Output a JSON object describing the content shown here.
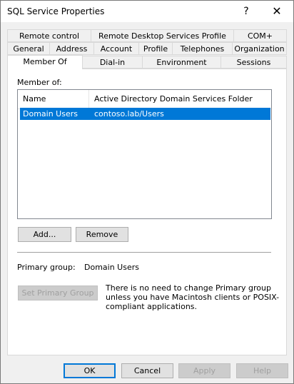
{
  "window": {
    "title": "SQL Service Properties",
    "help_glyph": "?",
    "close_glyph": "✕"
  },
  "tabs": {
    "row1": [
      "Remote control",
      "Remote Desktop Services Profile",
      "COM+"
    ],
    "row2": [
      "General",
      "Address",
      "Account",
      "Profile",
      "Telephones",
      "Organization"
    ],
    "row3": [
      "Member Of",
      "Dial-in",
      "Environment",
      "Sessions"
    ],
    "active": "Member Of"
  },
  "member_of": {
    "section_label": "Member of:",
    "columns": [
      "Name",
      "Active Directory Domain Services Folder"
    ],
    "rows": [
      {
        "name": "Domain Users",
        "folder": "contoso.lab/Users",
        "selected": true
      }
    ],
    "add_label": "Add...",
    "remove_label": "Remove"
  },
  "primary_group": {
    "label": "Primary group:",
    "value": "Domain Users",
    "set_button_label": "Set Primary Group",
    "info_text": "There is no need to change Primary group unless you have Macintosh clients or POSIX-compliant applications."
  },
  "footer": {
    "ok_label": "OK",
    "cancel_label": "Cancel",
    "apply_label": "Apply",
    "help_label": "Help"
  },
  "colors": {
    "selection": "#0078d7",
    "window_bg": "#f0f0f0",
    "default_button_border": "#0078d7"
  }
}
